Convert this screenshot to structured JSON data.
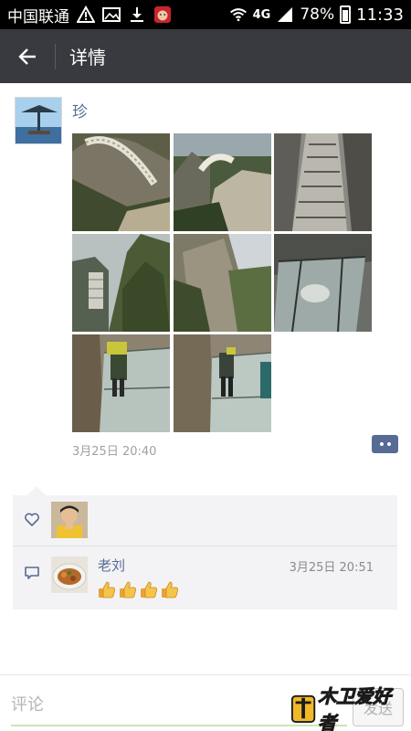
{
  "status_bar": {
    "carrier": "中国联通",
    "signal_type": "4G",
    "battery": "78%",
    "time": "11:33"
  },
  "app_bar": {
    "title": "详情"
  },
  "post": {
    "author": "珍",
    "time": "3月25日 20:40",
    "photo_count": 8
  },
  "interactions": {
    "comment": {
      "author": "老刘",
      "time": "3月25日 20:51",
      "thumbs_up_count": 4
    }
  },
  "input_bar": {
    "placeholder": "评论",
    "send_label": "发送"
  },
  "watermark": {
    "text": "木卫爱好者"
  },
  "colors": {
    "app_bar": "#393a3f",
    "link_blue": "#576b95",
    "panel_bg": "#f3f3f5"
  }
}
